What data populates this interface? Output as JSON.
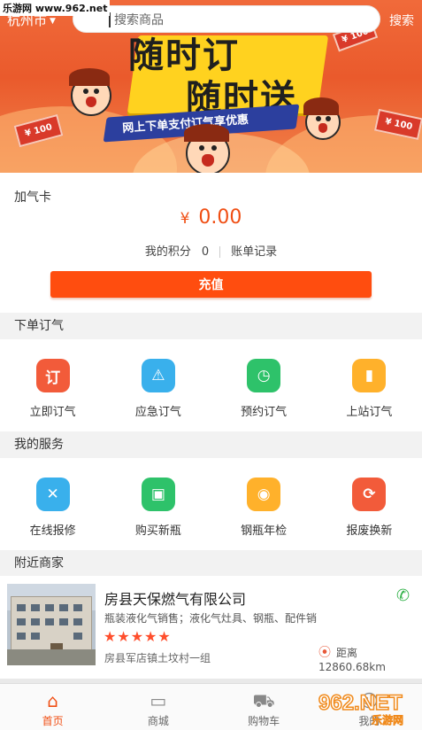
{
  "topbar": {
    "city": "杭州市",
    "search_placeholder": "搜索商品",
    "search_button": "搜索"
  },
  "banner": {
    "slogan_line1": "随时订",
    "slogan_line2": "随时送",
    "ribbon": "网上下单支付订气享优惠",
    "coin_label": "¥ 100"
  },
  "card": {
    "title": "加气卡",
    "currency": "¥",
    "balance": "0.00",
    "points_label": "我的积分",
    "points_value": "0",
    "records_label": "账单记录",
    "charge_button": "充值"
  },
  "order_section": {
    "title": "下单订气",
    "items": [
      {
        "label": "立即订气",
        "icon": "order-now-icon",
        "glyph": "订",
        "color": "#f25b3a"
      },
      {
        "label": "应急订气",
        "icon": "emergency-light-icon",
        "glyph": "⚠",
        "color": "#39b0ec"
      },
      {
        "label": "预约订气",
        "icon": "clock-icon",
        "glyph": "◷",
        "color": "#2ec26a"
      },
      {
        "label": "上站订气",
        "icon": "gas-cylinder-icon",
        "glyph": "▮",
        "color": "#ffb12b"
      }
    ]
  },
  "service_section": {
    "title": "我的服务",
    "items": [
      {
        "label": "在线报修",
        "icon": "repair-tools-icon",
        "glyph": "✕",
        "color": "#39b0ec"
      },
      {
        "label": "购买新瓶",
        "icon": "new-cylinder-icon",
        "glyph": "▣",
        "color": "#2ec26a"
      },
      {
        "label": "钢瓶年检",
        "icon": "inspection-icon",
        "glyph": "◉",
        "color": "#ffb12b"
      },
      {
        "label": "报废换新",
        "icon": "exchange-icon",
        "glyph": "⟳",
        "color": "#f25b3a"
      }
    ]
  },
  "nearby_section": {
    "title": "附近商家",
    "merchant": {
      "name": "房县天保燃气有限公司",
      "description": "瓶装液化气销售；液化气灶具、钢瓶、配件销",
      "rating": 5,
      "stars": "★★★★★",
      "address": "房县军店镇土坟村一组",
      "distance": "距离12860.68km"
    }
  },
  "tabbar": {
    "tabs": [
      {
        "label": "首页",
        "icon": "home-icon",
        "active": true
      },
      {
        "label": "商城",
        "icon": "store-icon",
        "active": false
      },
      {
        "label": "购物车",
        "icon": "cart-icon",
        "active": false
      },
      {
        "label": "我的",
        "icon": "profile-icon",
        "active": false
      }
    ]
  },
  "watermark": {
    "site": "乐游网 www.962.net",
    "logo_text": "962.NET",
    "logo_sub": "乐游网"
  },
  "colors": {
    "accent": "#f04e13",
    "button": "#ff4d0f",
    "star": "#ff4e2c",
    "phone": "#33b24a"
  }
}
